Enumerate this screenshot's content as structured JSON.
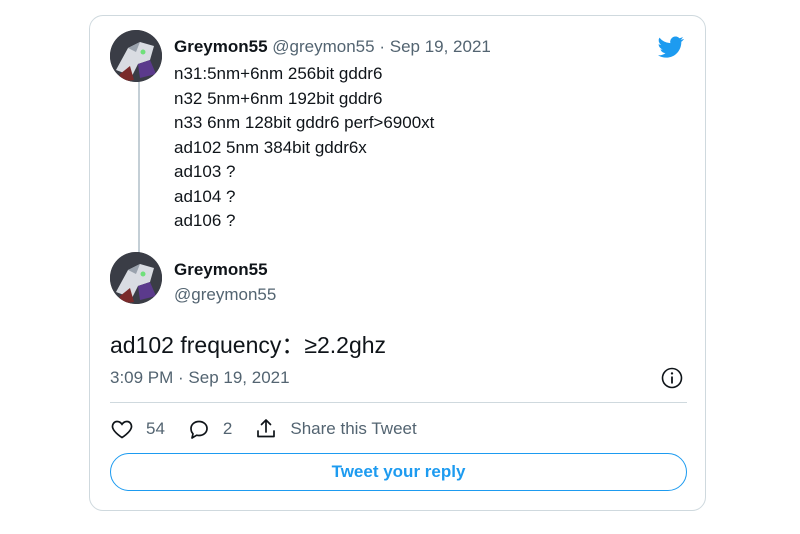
{
  "thread_tweet": {
    "display_name": "Greymon55",
    "handle": "@greymon55",
    "separator": "·",
    "date": "Sep 19, 2021",
    "lines": [
      "n31:5nm+6nm 256bit gddr6",
      "n32 5nm+6nm 192bit gddr6",
      "n33 6nm 128bit gddr6 perf>6900xt",
      "ad102 5nm 384bit gddr6x",
      "ad103 ?",
      "ad104 ?",
      "ad106 ?"
    ]
  },
  "main_tweet": {
    "display_name": "Greymon55",
    "handle": "@greymon55",
    "text": "ad102 frequency：≥2.2ghz",
    "timestamp": "3:09 PM · Sep 19, 2021"
  },
  "actions": {
    "likes": "54",
    "replies": "2",
    "share_label": "Share this Tweet"
  },
  "reply_button_label": "Tweet your reply",
  "icons": [
    "twitter-bird-icon",
    "info-icon",
    "heart-icon",
    "comment-icon",
    "share-icon"
  ],
  "colors": {
    "brand": "#1d9bf0",
    "muted": "#536471",
    "border": "#cfd9de"
  }
}
